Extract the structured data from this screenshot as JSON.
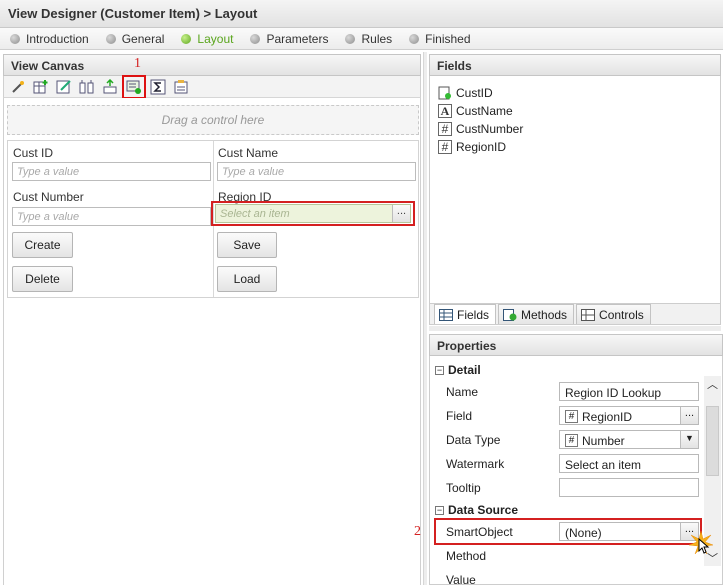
{
  "header": {
    "title": "View Designer (Customer Item) > Layout"
  },
  "steps": [
    {
      "label": "Introduction",
      "active": false
    },
    {
      "label": "General",
      "active": false
    },
    {
      "label": "Layout",
      "active": true
    },
    {
      "label": "Parameters",
      "active": false
    },
    {
      "label": "Rules",
      "active": false
    },
    {
      "label": "Finished",
      "active": false
    }
  ],
  "canvas": {
    "title": "View Canvas",
    "toolbar_icons": [
      "wand-icon",
      "add-table-icon",
      "edit-icon",
      "columns-icon",
      "align-icon",
      "lookup-insert-icon",
      "sum-icon",
      "properties-icon"
    ],
    "drop_hint": "Drag a control here",
    "form": {
      "cust_id_label": "Cust ID",
      "cust_id_placeholder": "Type a value",
      "cust_name_label": "Cust Name",
      "cust_name_placeholder": "Type a value",
      "cust_number_label": "Cust Number",
      "cust_number_placeholder": "Type a value",
      "region_id_label": "Region ID",
      "region_id_placeholder": "Select an item",
      "lookup_button": "...",
      "create": "Create",
      "save": "Save",
      "delete": "Delete",
      "load": "Load"
    }
  },
  "fields_panel": {
    "title": "Fields",
    "items": [
      {
        "name": "CustID",
        "icon": "key-field-icon"
      },
      {
        "name": "CustName",
        "icon": "text-field-icon"
      },
      {
        "name": "CustNumber",
        "icon": "number-field-icon"
      },
      {
        "name": "RegionID",
        "icon": "number-field-icon"
      }
    ],
    "tabs": [
      "Fields",
      "Methods",
      "Controls"
    ]
  },
  "properties": {
    "title": "Properties",
    "detail_section": "Detail",
    "rows": [
      {
        "label": "Name",
        "value": "Region ID Lookup"
      },
      {
        "label": "Field",
        "value": "RegionID"
      },
      {
        "label": "Data Type",
        "value": "Number"
      },
      {
        "label": "Watermark",
        "value": "Select an item"
      },
      {
        "label": "Tooltip",
        "value": ""
      }
    ],
    "data_source_section": "Data Source",
    "smartobject_label": "SmartObject",
    "smartobject_value": "(None)",
    "method_label": "Method",
    "value_label": "Value",
    "lookup_button": "..."
  },
  "annotations": {
    "step1": "1",
    "step2": "2"
  }
}
